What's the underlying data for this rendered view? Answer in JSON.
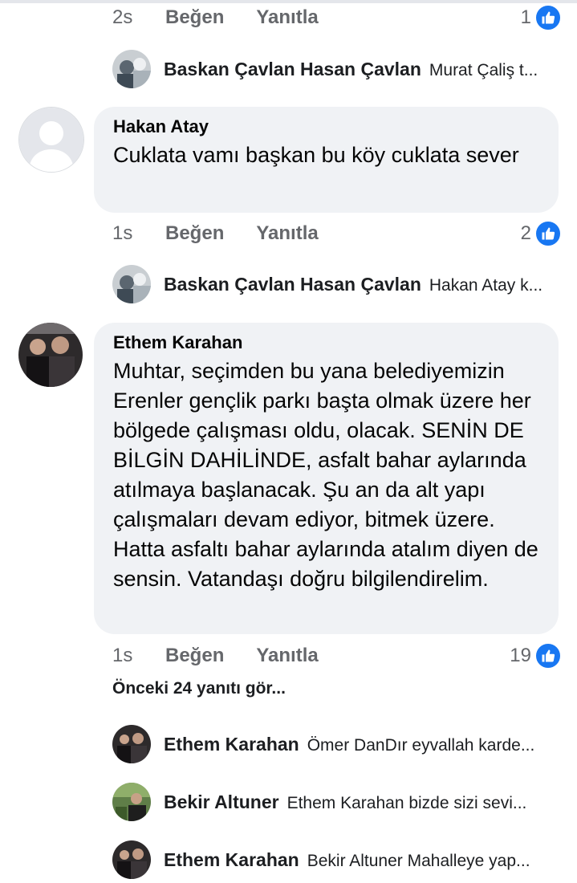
{
  "colors": {
    "like_blue": "#1877f2",
    "bubble_bg": "#f0f2f5",
    "meta_gray": "#65676b"
  },
  "row1": {
    "time": "2s",
    "like": "Beğen",
    "reply": "Yanıtla",
    "count": "1",
    "icon": "like-icon"
  },
  "reply1": {
    "name": "Baskan Çavlan Hasan Çavlan",
    "snippet": "Murat Çaliş t..."
  },
  "comment1": {
    "author": "Hakan Atay",
    "text": "Cuklata vamı başkan bu köy cuklata sever"
  },
  "row2": {
    "time": "1s",
    "like": "Beğen",
    "reply": "Yanıtla",
    "count": "2",
    "icon": "like-icon"
  },
  "reply2": {
    "name": "Baskan Çavlan Hasan Çavlan",
    "snippet": "Hakan Atay k..."
  },
  "comment2": {
    "author": "Ethem Karahan",
    "text": "Muhtar, seçimden bu yana belediyemizin Erenler gençlik parkı başta olmak üzere her bölgede çalışması oldu, olacak. SENİN DE BİLGİN DAHİLİNDE, asfalt bahar aylarında atılmaya başlanacak. Şu an da alt yapı çalışmaları devam ediyor, bitmek üzere. Hatta asfaltı bahar aylarında atalım diyen de sensin. Vatandaşı doğru bilgilendirelim."
  },
  "row3": {
    "time": "1s",
    "like": "Beğen",
    "reply": "Yanıtla",
    "count": "19",
    "icon": "like-icon"
  },
  "previous_replies": "Önceki 24 yanıtı gör...",
  "replies": [
    {
      "name": "Ethem Karahan",
      "snippet": "Ömer DanDır eyvallah karde..."
    },
    {
      "name": "Bekir Altuner",
      "snippet": "Ethem Karahan bizde sizi sevi..."
    },
    {
      "name": "Ethem Karahan",
      "snippet": "Bekir Altuner Mahalleye yap..."
    }
  ]
}
